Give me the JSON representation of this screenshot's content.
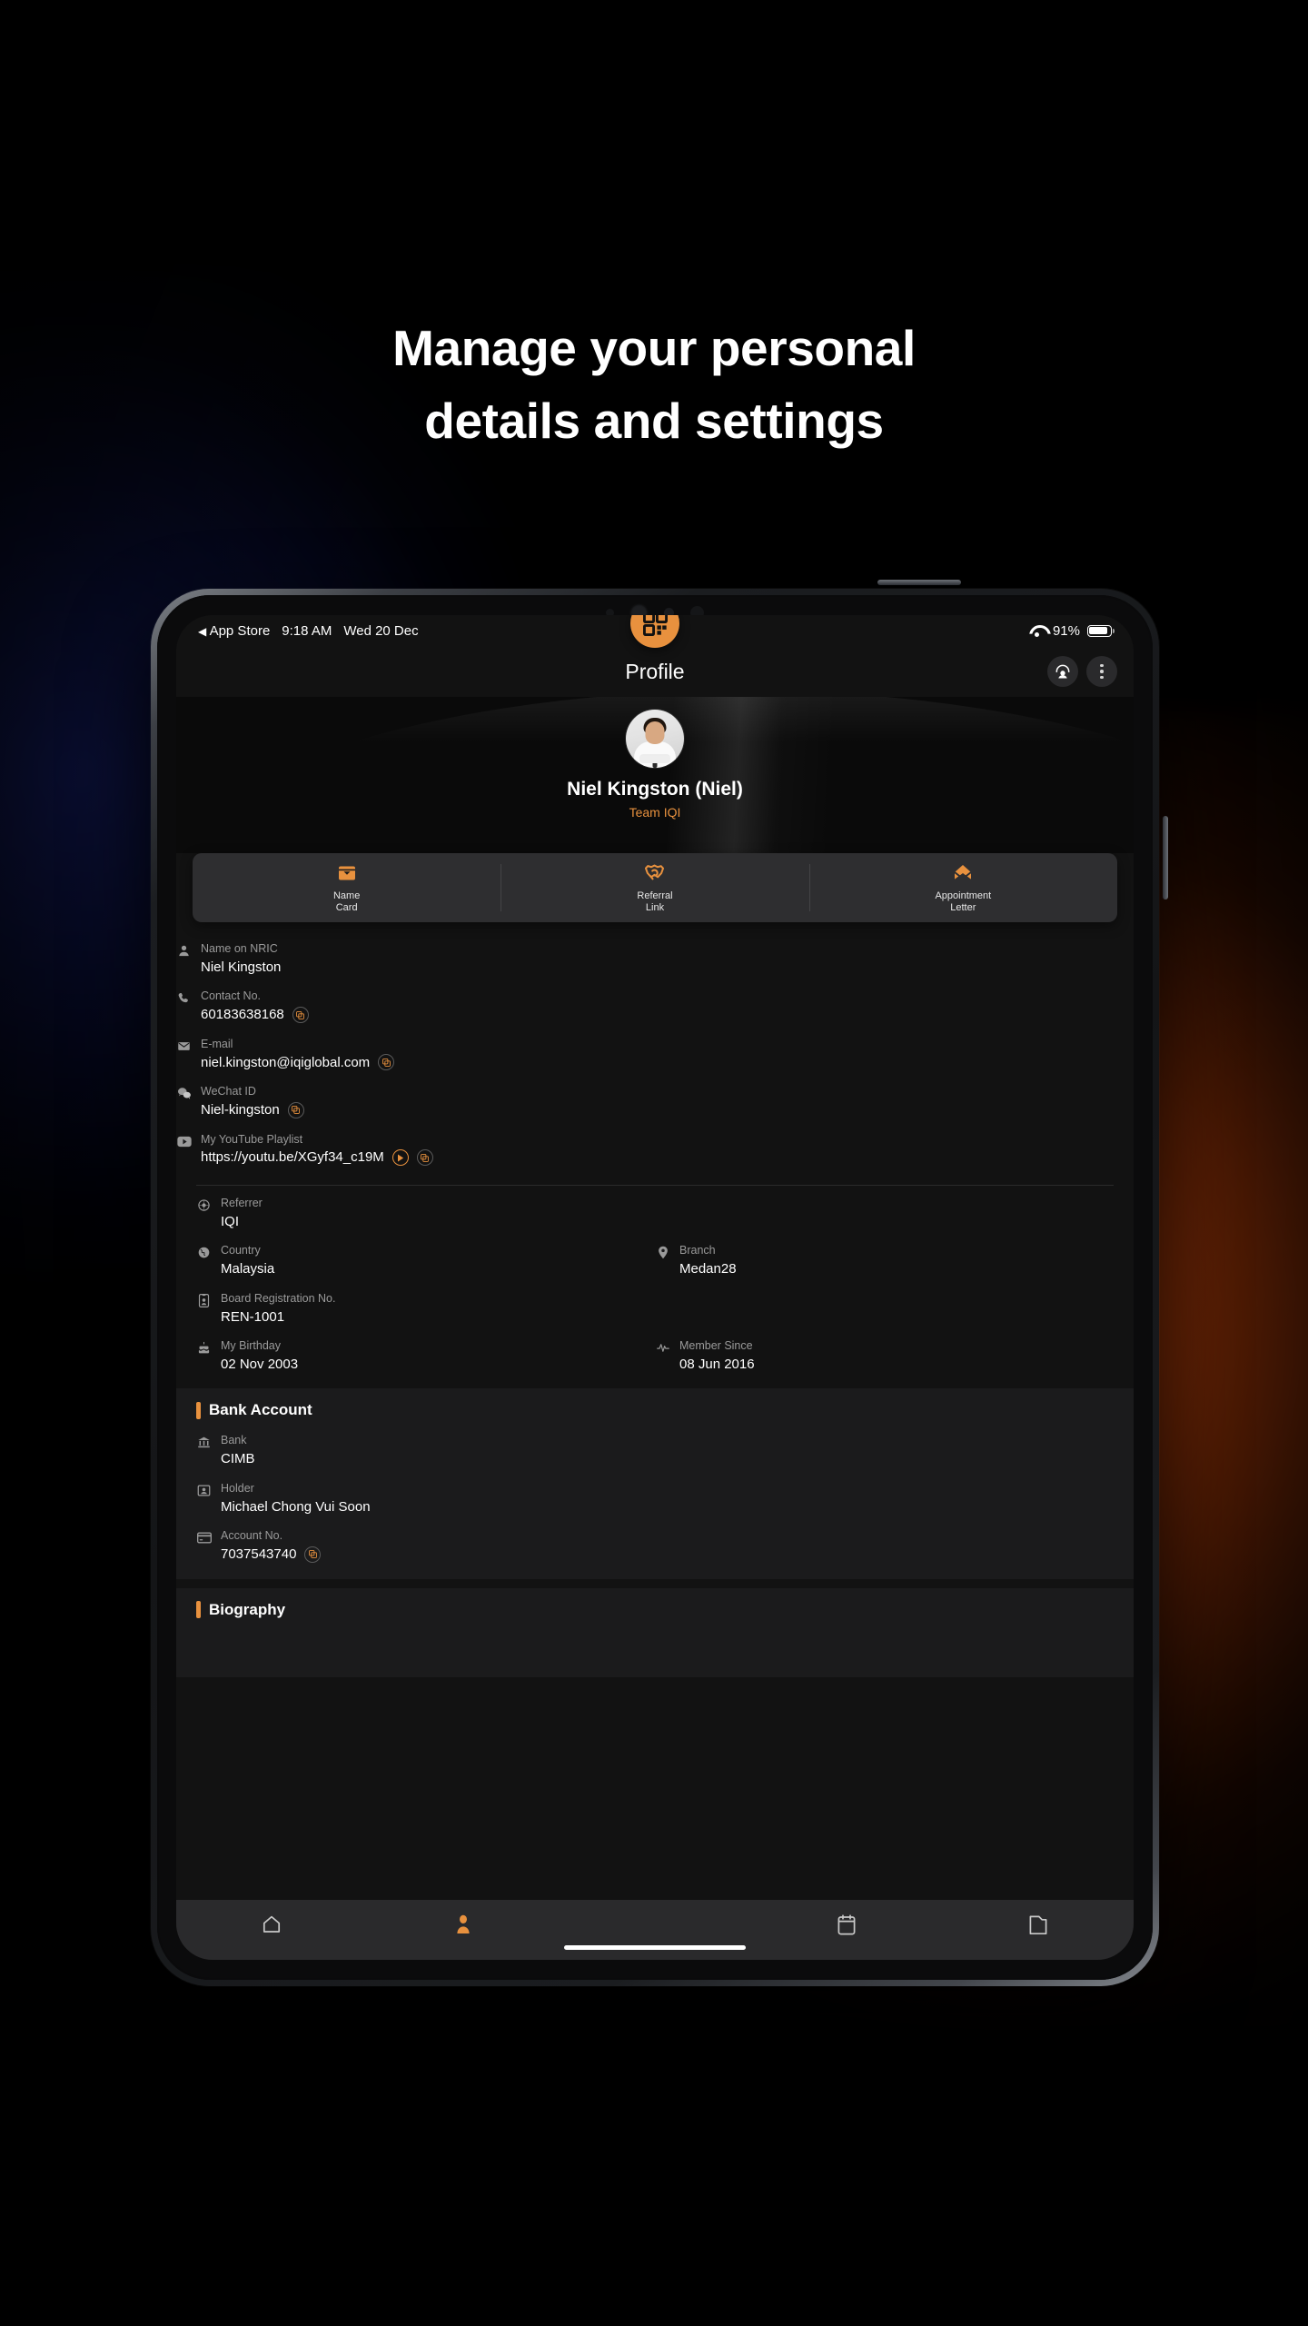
{
  "headline": {
    "line1": "Manage your personal",
    "line2": "details and settings"
  },
  "colors": {
    "accent": "#E8913E",
    "screen_bg": "#121212",
    "card_bg": "#2e2e30",
    "section_bg": "#1b1b1c"
  },
  "status_bar": {
    "back_glyph": "◀",
    "back_app": "App Store",
    "time": "9:18 AM",
    "date": "Wed 20 Dec",
    "wifi_icon": "wifi-icon",
    "battery_percent": "91%",
    "battery_icon": "battery-icon"
  },
  "nav_bar": {
    "title": "Profile",
    "support_icon": "headset-support-icon",
    "overflow_icon": "more-vertical-icon"
  },
  "profile": {
    "avatar_icon": "user-avatar",
    "name": "Niel Kingston (Niel)",
    "team": "Team IQI"
  },
  "actions": [
    {
      "icon": "name-card-icon",
      "label_line1": "Name",
      "label_line2": "Card"
    },
    {
      "icon": "handshake-referral-icon",
      "label_line1": "Referral",
      "label_line2": "Link"
    },
    {
      "icon": "envelope-letter-icon",
      "label_line1": "Appointment",
      "label_line2": "Letter"
    }
  ],
  "details_primary": [
    {
      "icon": "person-icon",
      "label": "Name on NRIC",
      "value": "Niel Kingston",
      "copy": false,
      "play": false
    },
    {
      "icon": "phone-icon",
      "label": "Contact No.",
      "value": "60183638168",
      "copy": true,
      "play": false
    },
    {
      "icon": "mail-icon",
      "label": "E-mail",
      "value": "niel.kingston@iqiglobal.com",
      "copy": true,
      "play": false
    },
    {
      "icon": "wechat-icon",
      "label": "WeChat ID",
      "value": "Niel-kingston",
      "copy": true,
      "play": false
    },
    {
      "icon": "youtube-icon",
      "label": "My YouTube Playlist",
      "value": "https://youtu.be/XGyf34_c19M",
      "copy": true,
      "play": true
    }
  ],
  "details_secondary": {
    "referrer": {
      "icon": "referrer-icon",
      "label": "Referrer",
      "value": "IQI"
    },
    "country": {
      "icon": "globe-icon",
      "label": "Country",
      "value": "Malaysia"
    },
    "branch": {
      "icon": "location-pin-icon",
      "label": "Branch",
      "value": "Medan28"
    },
    "board_reg": {
      "icon": "id-badge-icon",
      "label": "Board Registration No.",
      "value": "REN-1001"
    },
    "birthday": {
      "icon": "birthday-cake-icon",
      "label": "My Birthday",
      "value": "02 Nov 2003"
    },
    "member_since": {
      "icon": "pulse-icon",
      "label": "Member Since",
      "value": "08 Jun 2016"
    }
  },
  "bank_account": {
    "title": "Bank Account",
    "rows": [
      {
        "icon": "bank-icon",
        "label": "Bank",
        "value": "CIMB",
        "copy": false
      },
      {
        "icon": "id-card-icon",
        "label": "Holder",
        "value": "Michael Chong Vui Soon",
        "copy": false
      },
      {
        "icon": "credit-card-icon",
        "label": "Account No.",
        "value": "7037543740",
        "copy": true
      }
    ]
  },
  "biography": {
    "title": "Biography"
  },
  "tab_bar": {
    "items": [
      {
        "icon": "home-icon",
        "active": false
      },
      {
        "icon": "profile-person-icon",
        "active": true
      },
      {
        "icon": "calendar-icon",
        "active": false
      },
      {
        "icon": "folder-icon",
        "active": false
      }
    ],
    "fab_icon": "qr-code-icon"
  }
}
